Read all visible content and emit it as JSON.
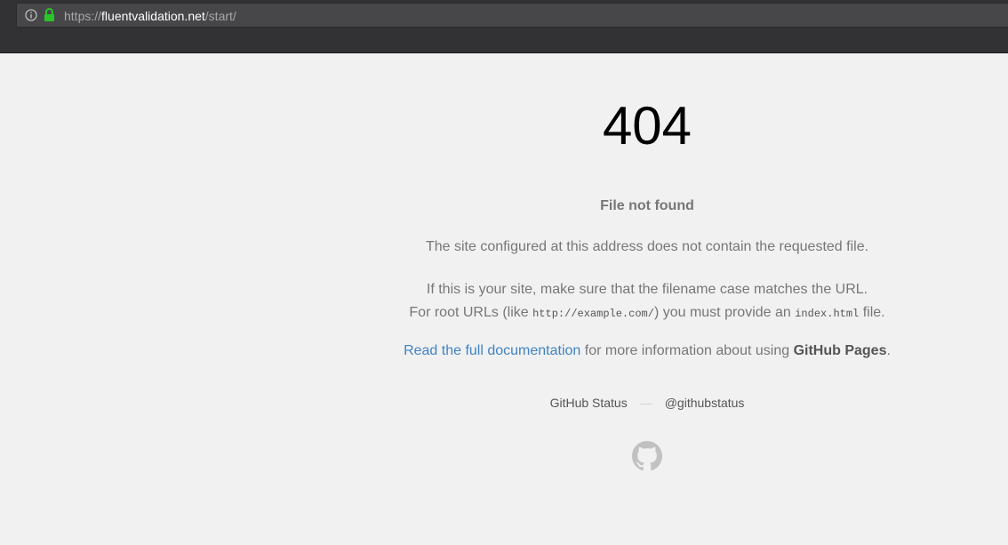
{
  "browser": {
    "url_scheme": "https://",
    "url_host": "fluentvalidation.net",
    "url_path": "/start/"
  },
  "page": {
    "code": "404",
    "title": "File not found",
    "line1": "The site configured at this address does not contain the requested file.",
    "line2": "If this is your site, make sure that the filename case matches the URL.",
    "line3_pre": "For root URLs (like ",
    "line3_code1": "http://example.com/",
    "line3_mid": ") you must provide an ",
    "line3_code2": "index.html",
    "line3_post": " file.",
    "doc_link": "Read the full documentation",
    "doc_mid": " for more information about using ",
    "doc_strong": "GitHub Pages",
    "doc_end": "."
  },
  "footer": {
    "status_link": "GitHub Status",
    "separator": "—",
    "twitter_link": "@githubstatus"
  },
  "colors": {
    "link": "#4183c4",
    "background": "#f1f1f1",
    "lock": "#2ac52a"
  },
  "icons": {
    "info": "info-icon",
    "lock": "lock-icon",
    "logo": "github-octocat-icon"
  }
}
